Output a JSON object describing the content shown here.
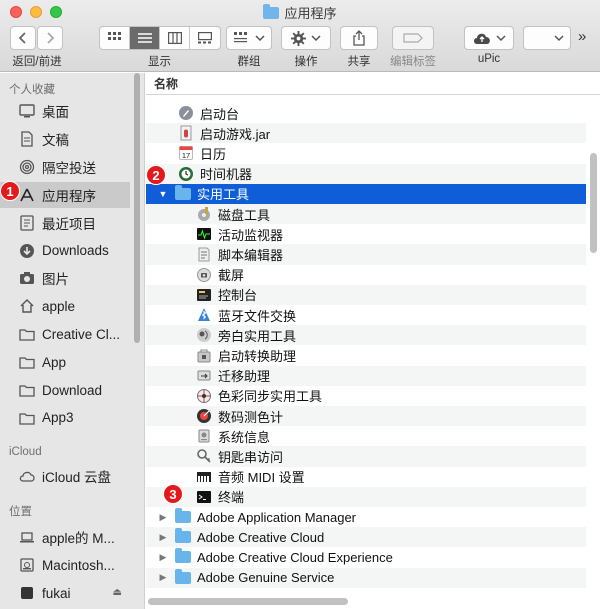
{
  "window": {
    "title": "应用程序"
  },
  "toolbar": {
    "nav_label": "返回/前进",
    "view_label": "显示",
    "group_label": "群组",
    "action_label": "操作",
    "share_label": "共享",
    "tags_label": "编辑标签",
    "upic_label": "uPic",
    "overflow": "»"
  },
  "sidebar": {
    "favorites_heading": "个人收藏",
    "favorites": [
      {
        "label": "桌面",
        "icon": "desktop-icon"
      },
      {
        "label": "文稿",
        "icon": "document-icon"
      },
      {
        "label": "隔空投送",
        "icon": "airdrop-icon"
      },
      {
        "label": "应用程序",
        "icon": "applications-icon",
        "selected": true
      },
      {
        "label": "最近项目",
        "icon": "recents-icon"
      },
      {
        "label": "Downloads",
        "icon": "downloads-icon"
      },
      {
        "label": "图片",
        "icon": "camera-icon"
      },
      {
        "label": "apple",
        "icon": "home-icon"
      },
      {
        "label": "Creative Cl...",
        "icon": "folder-icon"
      },
      {
        "label": "App",
        "icon": "folder-icon"
      },
      {
        "label": "Download",
        "icon": "folder-icon"
      },
      {
        "label": "App3",
        "icon": "folder-icon"
      }
    ],
    "icloud_heading": "iCloud",
    "icloud": [
      {
        "label": "iCloud 云盘",
        "icon": "cloud-icon"
      }
    ],
    "locations_heading": "位置",
    "locations": [
      {
        "label": "apple的 M...",
        "icon": "laptop-icon"
      },
      {
        "label": "Macintosh...",
        "icon": "hard-drive-icon"
      },
      {
        "label": "fukai",
        "icon": "drive-icon",
        "eject": "⏏"
      }
    ]
  },
  "list": {
    "column_name": "名称",
    "rows": [
      {
        "label": "启动台",
        "icon": "launchpad-icon",
        "indent": 0
      },
      {
        "label": "启动游戏.jar",
        "icon": "jar-icon",
        "indent": 0
      },
      {
        "label": "日历",
        "icon": "calendar-icon",
        "indent": 0,
        "icon_text": "17"
      },
      {
        "label": "时间机器",
        "icon": "time-machine-icon",
        "indent": 0
      },
      {
        "label": "实用工具",
        "icon": "folder-icon",
        "indent": 0,
        "disclosure": "▼",
        "selected": true
      },
      {
        "label": "磁盘工具",
        "icon": "disk-utility-icon",
        "indent": 1
      },
      {
        "label": "活动监视器",
        "icon": "activity-monitor-icon",
        "indent": 1
      },
      {
        "label": "脚本编辑器",
        "icon": "script-editor-icon",
        "indent": 1
      },
      {
        "label": "截屏",
        "icon": "screenshot-icon",
        "indent": 1
      },
      {
        "label": "控制台",
        "icon": "console-icon",
        "indent": 1
      },
      {
        "label": "蓝牙文件交换",
        "icon": "bluetooth-icon",
        "indent": 1
      },
      {
        "label": "旁白实用工具",
        "icon": "voiceover-icon",
        "indent": 1
      },
      {
        "label": "启动转换助理",
        "icon": "boot-camp-icon",
        "indent": 1
      },
      {
        "label": "迁移助理",
        "icon": "migration-icon",
        "indent": 1
      },
      {
        "label": "色彩同步实用工具",
        "icon": "colorsync-icon",
        "indent": 1
      },
      {
        "label": "数码测色计",
        "icon": "color-meter-icon",
        "indent": 1
      },
      {
        "label": "系统信息",
        "icon": "system-info-icon",
        "indent": 1
      },
      {
        "label": "钥匙串访问",
        "icon": "keychain-icon",
        "indent": 1
      },
      {
        "label": "音频 MIDI 设置",
        "icon": "midi-icon",
        "indent": 1
      },
      {
        "label": "终端",
        "icon": "terminal-icon",
        "indent": 1
      },
      {
        "label": "Adobe Application Manager",
        "icon": "folder-icon",
        "indent": 0,
        "disclosure": "▶"
      },
      {
        "label": "Adobe Creative Cloud",
        "icon": "folder-icon",
        "indent": 0,
        "disclosure": "▶"
      },
      {
        "label": "Adobe Creative Cloud Experience",
        "icon": "folder-icon",
        "indent": 0,
        "disclosure": "▶"
      },
      {
        "label": "Adobe Genuine Service",
        "icon": "folder-icon",
        "indent": 0,
        "disclosure": "▶"
      }
    ]
  },
  "annotations": [
    "1",
    "2",
    "3"
  ],
  "colors": {
    "selection": "#0f5ed8",
    "badge": "#e3191b",
    "folder": "#68b5ec"
  }
}
